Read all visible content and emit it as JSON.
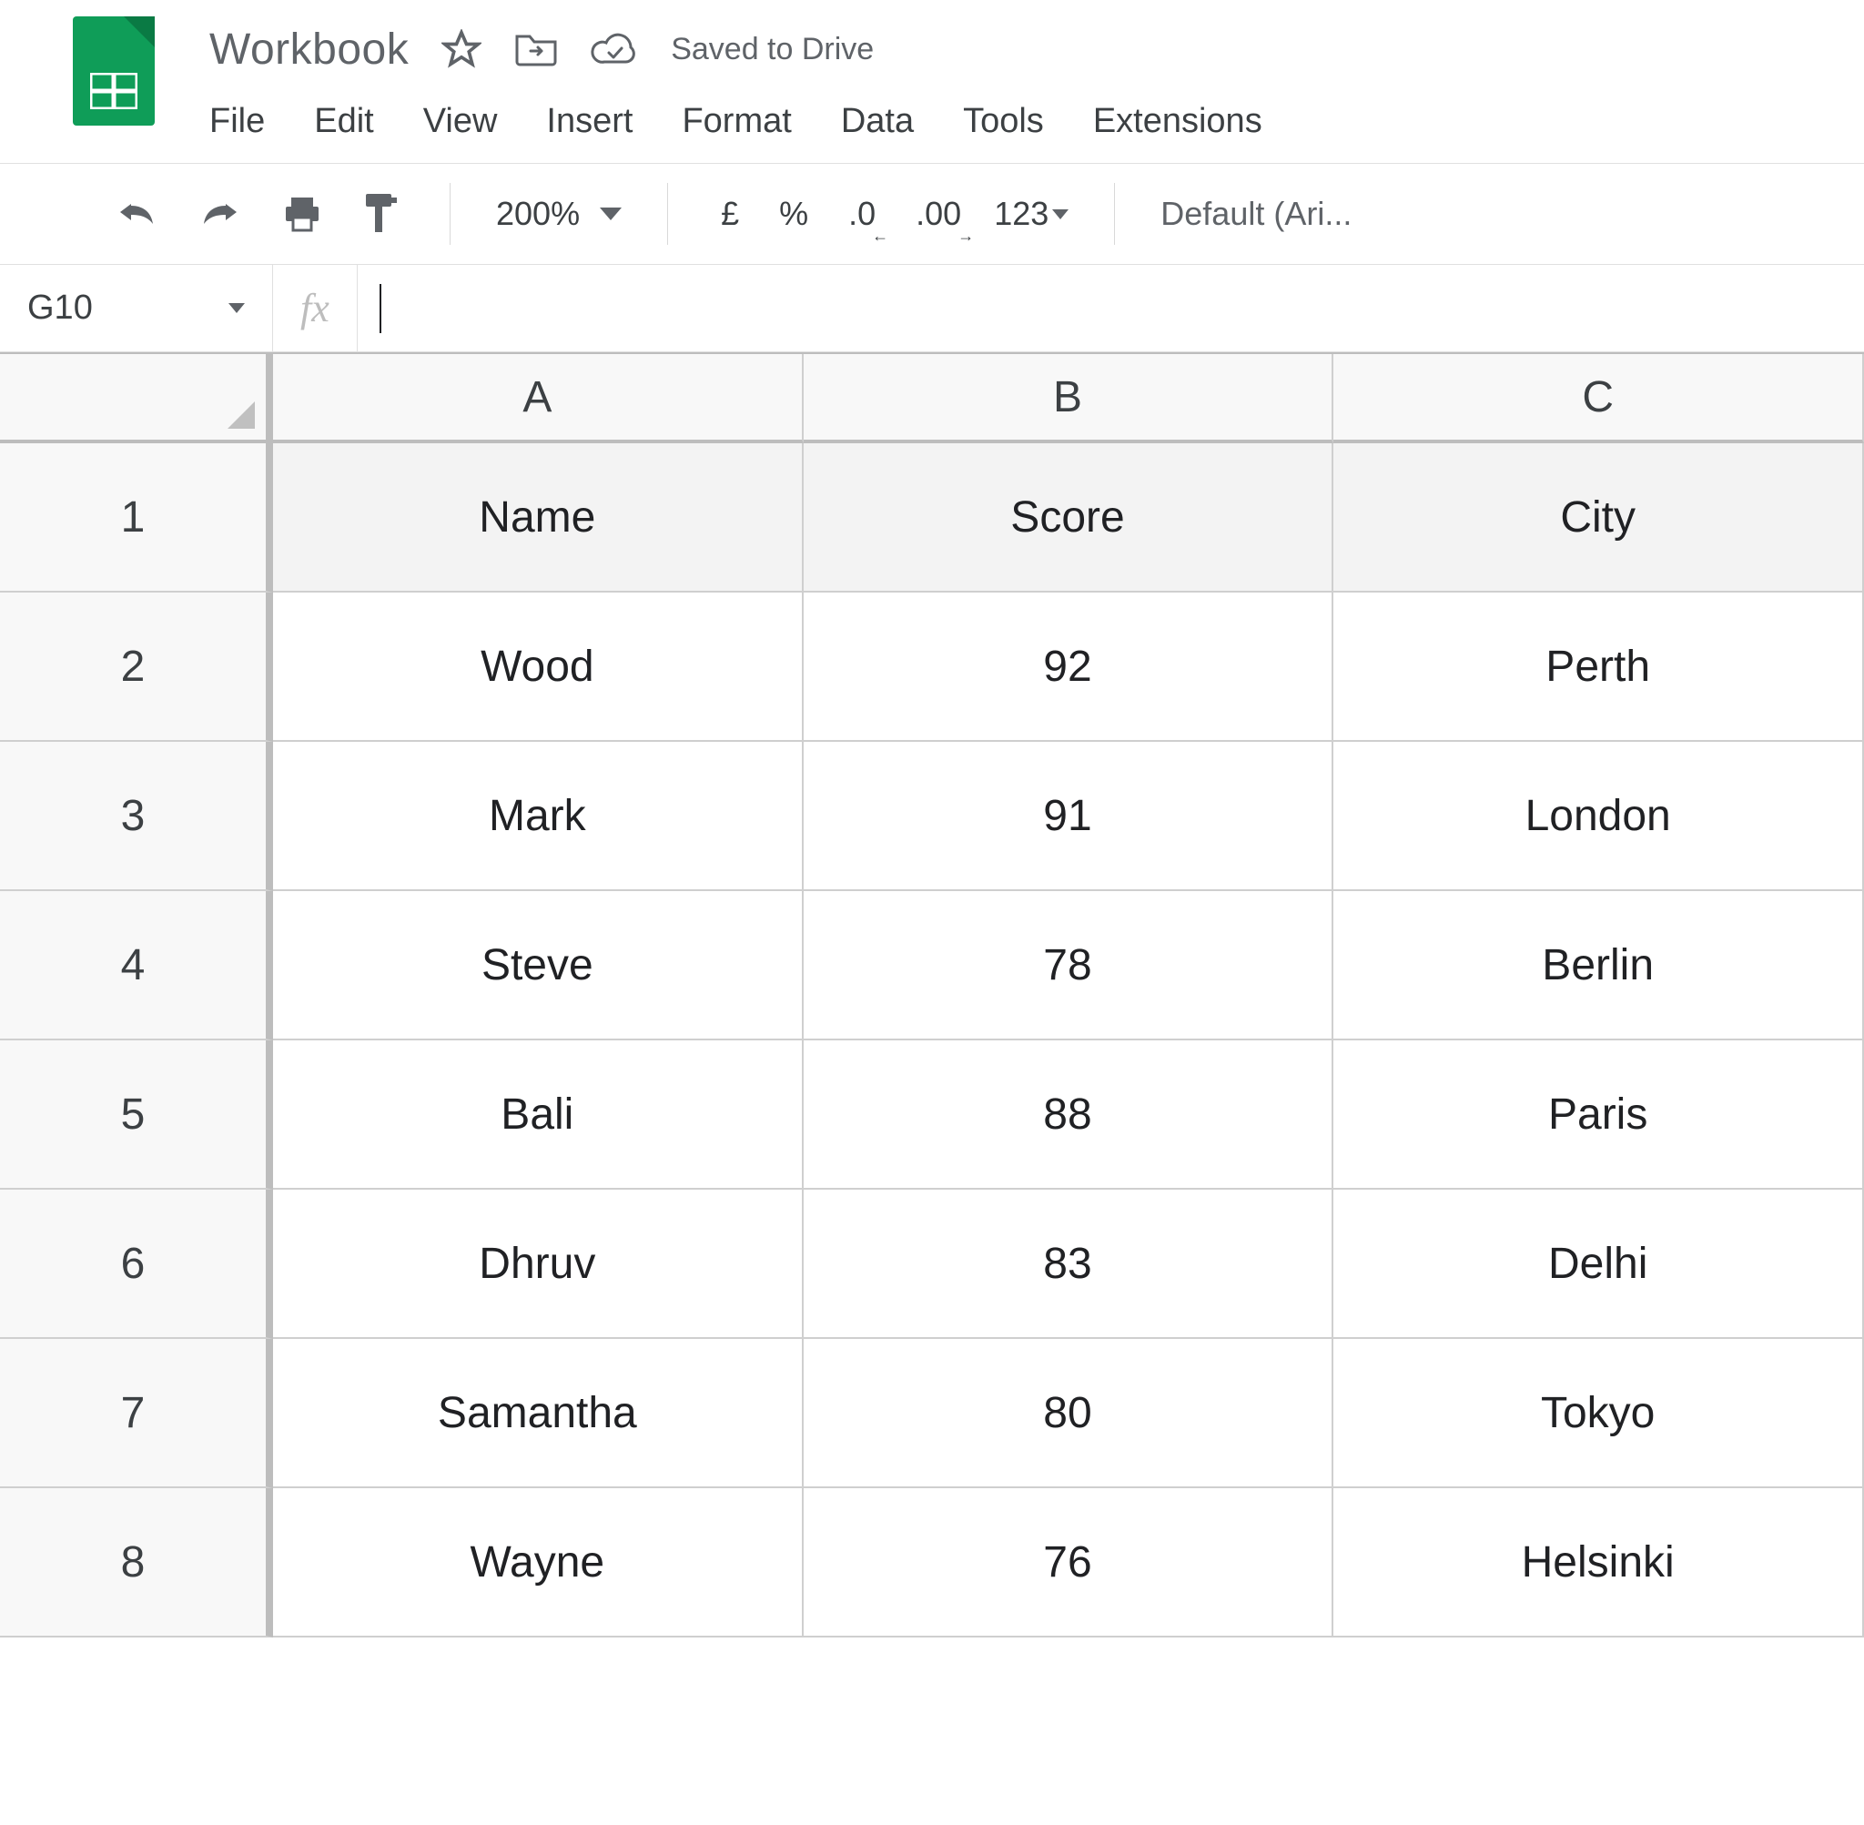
{
  "header": {
    "doc_title": "Workbook",
    "saved_text": "Saved to Drive"
  },
  "menubar": {
    "items": [
      "File",
      "Edit",
      "View",
      "Insert",
      "Format",
      "Data",
      "Tools",
      "Extensions"
    ]
  },
  "toolbar": {
    "zoom": "200%",
    "currency": "£",
    "percent": "%",
    "dec_decrease": ".0",
    "dec_increase": ".00",
    "num_format": "123",
    "font": "Default (Ari..."
  },
  "fxbar": {
    "namebox": "G10",
    "fx_label": "fx",
    "formula": ""
  },
  "sheet": {
    "col_letters": [
      "A",
      "B",
      "C"
    ],
    "row_numbers": [
      "1",
      "2",
      "3",
      "4",
      "5",
      "6",
      "7",
      "8"
    ],
    "rows": [
      {
        "A": "Name",
        "B": "Score",
        "C": "City",
        "is_header": true
      },
      {
        "A": "Wood",
        "B": "92",
        "C": "Perth",
        "is_header": false
      },
      {
        "A": "Mark",
        "B": "91",
        "C": "London",
        "is_header": false
      },
      {
        "A": "Steve",
        "B": "78",
        "C": "Berlin",
        "is_header": false
      },
      {
        "A": "Bali",
        "B": "88",
        "C": "Paris",
        "is_header": false
      },
      {
        "A": "Dhruv",
        "B": "83",
        "C": "Delhi",
        "is_header": false
      },
      {
        "A": "Samantha",
        "B": "80",
        "C": "Tokyo",
        "is_header": false
      },
      {
        "A": "Wayne",
        "B": "76",
        "C": "Helsinki",
        "is_header": false
      }
    ]
  }
}
